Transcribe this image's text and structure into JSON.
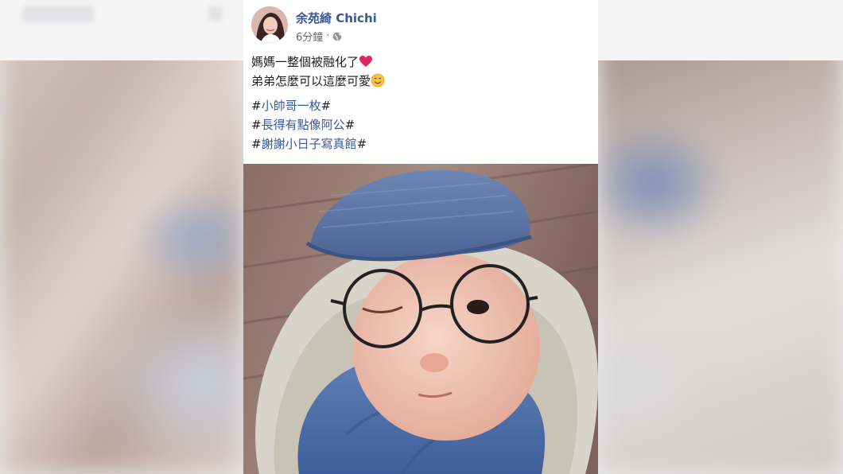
{
  "post": {
    "author": "余苑綺 Chichi",
    "time": "6分鐘",
    "separator": "·",
    "audience_icon": "globe-icon",
    "lines": [
      "媽媽一整個被融化了",
      "弟弟怎麼可以這麼可愛"
    ],
    "emojis": [
      "red-heart",
      "smiling-face"
    ],
    "hashtags": [
      {
        "prefix": "#",
        "text": "小帥哥一枚",
        "suffix": "#"
      },
      {
        "prefix": "#",
        "text": "長得有點像阿公",
        "suffix": "#"
      },
      {
        "prefix": "#",
        "text": "謝謝小日子寫真館",
        "suffix": "#"
      }
    ],
    "photo_subject": "baby wearing blue newsboy cap and round glasses, wrapped in blue cloth"
  },
  "colors": {
    "author_link": "#385898",
    "hashtag_link": "#385898",
    "text": "#1c1e21",
    "meta": "#606770",
    "heart": "#e0245e",
    "card_bg": "#ffffff"
  }
}
